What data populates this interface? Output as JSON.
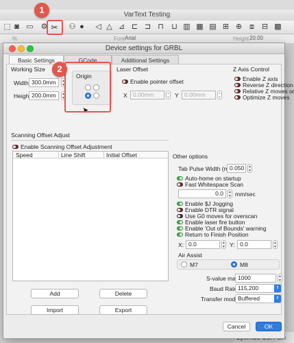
{
  "app": {
    "title": "VarText Testing",
    "font_label": "Font",
    "font_value": "Arial",
    "height_label": "Height",
    "height_value": "20.00",
    "percent_sign": "%",
    "bottom_peek": "Optimize Cut Path"
  },
  "callouts": {
    "one": "1",
    "two": "2"
  },
  "dialog": {
    "title": "Device settings for GRBL",
    "tabs": [
      "Basic Settings",
      "GCode",
      "Additional Settings"
    ],
    "working_size": {
      "heading": "Working Size",
      "width_label": "Width",
      "width_value": "300.0mm",
      "height_label": "Height",
      "height_value": "200.0mm"
    },
    "origin": {
      "heading": "Origin"
    },
    "laser_offset": {
      "heading": "Laser Offset",
      "enable_label": "Enable pointer offset",
      "enable_on": false,
      "x_label": "X",
      "x_value": "0.00mm",
      "y_label": "Y",
      "y_value": "0.00mm"
    },
    "z_axis": {
      "heading": "Z Axis Control",
      "options": [
        {
          "label": "Enable Z axis",
          "on": false
        },
        {
          "label": "Reverse Z direction",
          "on": false
        },
        {
          "label": "Relative Z moves only",
          "on": false
        },
        {
          "label": "Optimize Z moves",
          "on": false
        }
      ]
    },
    "scanning": {
      "heading": "Scanning Offset Adjust",
      "enable_label": "Enable Scanning Offset Adjustment",
      "enable_on": false,
      "columns": [
        "Speed",
        "Line Shift",
        "Initial Offset"
      ],
      "buttons": {
        "add": "Add",
        "delete": "Delete",
        "import": "Import",
        "export": "Export"
      }
    },
    "other": {
      "heading": "Other options",
      "tab_pulse_label": "Tab Pulse Width (mm)",
      "tab_pulse_value": "0.050",
      "auto_home_label": "Auto-home on startup",
      "fast_ws_label": "Fast Whitespace Scan",
      "speed_value": "0.0",
      "speed_unit": "mm/sec",
      "options": [
        {
          "label": "Enable $J Jogging",
          "state": "on"
        },
        {
          "label": "Enable DTR signal",
          "state": "off"
        },
        {
          "label": "Use G0 moves for overscan",
          "state": "dark"
        },
        {
          "label": "Enable laser fire button",
          "state": "on"
        },
        {
          "label": "Enable 'Out of Bounds' warning",
          "state": "on"
        },
        {
          "label": "Return to Finish Position",
          "state": "on"
        }
      ],
      "return_x_label": "X:",
      "return_x_value": "0.0",
      "return_y_label": "Y:",
      "return_y_value": "0.0",
      "air_assist_label": "Air Assist",
      "m7_label": "M7",
      "m8_label": "M8",
      "air_assist_selected": "M8",
      "svalue_label": "S-value max",
      "svalue_value": "1000",
      "baud_label": "Baud Rate",
      "baud_value": "115,200",
      "transfer_label": "Transfer mode",
      "transfer_value": "Buffered"
    },
    "footer": {
      "cancel": "Cancel",
      "ok": "OK"
    }
  },
  "colors": {
    "callout_red": "#e2574c",
    "toggle_on": "#3cb043",
    "toggle_off": "#6b2b2b",
    "accent_blue": "#2f7de1"
  }
}
